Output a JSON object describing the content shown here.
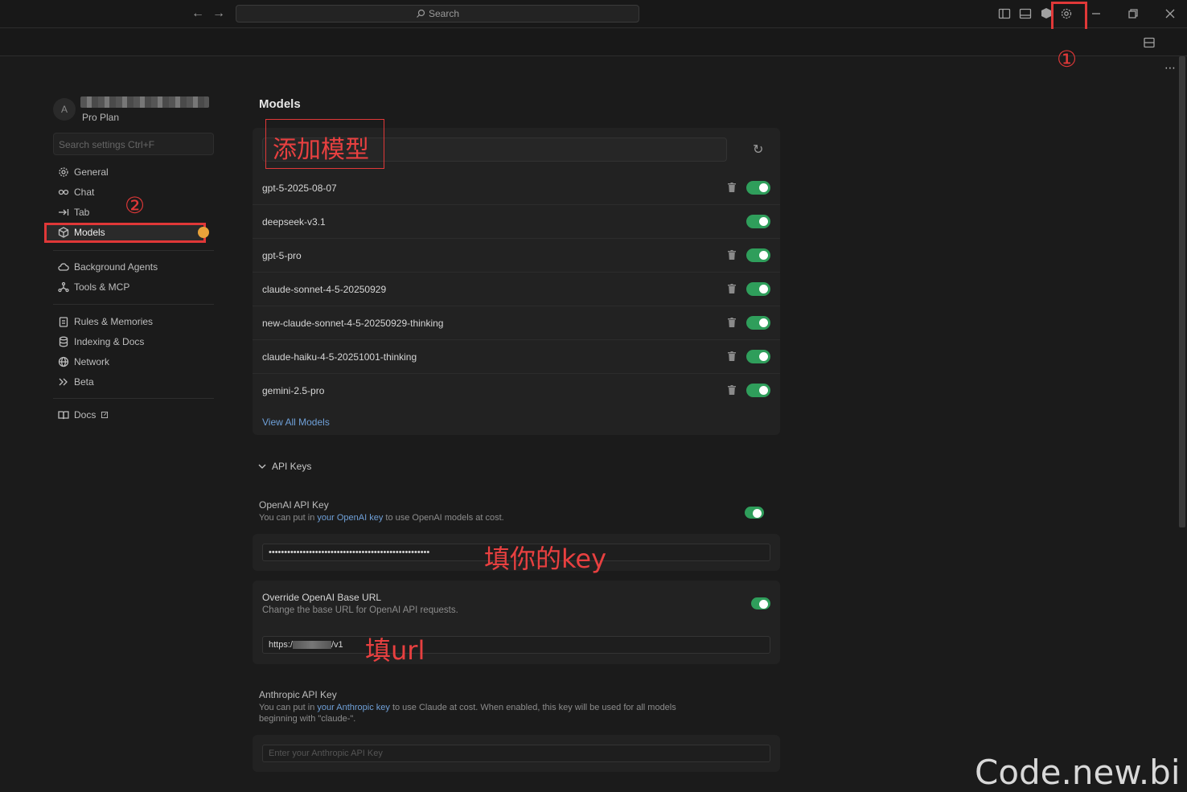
{
  "titlebar": {
    "search_label": "Search",
    "icons": [
      "back-arrow-icon",
      "forward-arrow-icon",
      "search-icon",
      "sidebar-left-icon",
      "panel-bottom-icon",
      "cube-icon",
      "gear-icon",
      "minimize-icon",
      "restore-icon",
      "close-icon"
    ]
  },
  "annotations": {
    "circle1": "①",
    "circle2": "②",
    "add_model": "添加模型",
    "fill_key": "填你的key",
    "fill_url": "填url",
    "watermark": "Code.new.bi"
  },
  "account": {
    "avatar_letter": "A",
    "plan": "Pro Plan"
  },
  "sidebar": {
    "search_placeholder": "Search settings Ctrl+F",
    "items": [
      {
        "label": "General",
        "icon": "gear-icon"
      },
      {
        "label": "Chat",
        "icon": "infinity-icon"
      },
      {
        "label": "Tab",
        "icon": "tab-arrow-icon"
      },
      {
        "label": "Models",
        "icon": "cube-icon"
      },
      {
        "label": "Background Agents",
        "icon": "cloud-icon"
      },
      {
        "label": "Tools & MCP",
        "icon": "nodes-icon"
      },
      {
        "label": "Rules & Memories",
        "icon": "clipboard-icon"
      },
      {
        "label": "Indexing & Docs",
        "icon": "database-icon"
      },
      {
        "label": "Network",
        "icon": "globe-icon"
      },
      {
        "label": "Beta",
        "icon": "chevrons-icon"
      },
      {
        "label": "Docs",
        "icon": "book-icon"
      }
    ]
  },
  "main": {
    "title": "Models",
    "models": [
      {
        "name": "gpt-5-2025-08-07",
        "deletable": true,
        "enabled": true
      },
      {
        "name": "deepseek-v3.1",
        "deletable": false,
        "enabled": true
      },
      {
        "name": "gpt-5-pro",
        "deletable": true,
        "enabled": true
      },
      {
        "name": "claude-sonnet-4-5-20250929",
        "deletable": true,
        "enabled": true
      },
      {
        "name": "new-claude-sonnet-4-5-20250929-thinking",
        "deletable": true,
        "enabled": true
      },
      {
        "name": "claude-haiku-4-5-20251001-thinking",
        "deletable": true,
        "enabled": true
      },
      {
        "name": "gemini-2.5-pro",
        "deletable": true,
        "enabled": true
      }
    ],
    "view_all": "View All Models",
    "api_keys_header": "API Keys",
    "openai": {
      "label": "OpenAI API Key",
      "desc_pre": "You can put in ",
      "desc_link": "your OpenAI key",
      "desc_post": " to use OpenAI models at cost.",
      "key_value": "••••••••••••••••••••••••••••••••••••••••••••••••••••"
    },
    "override": {
      "label": "Override OpenAI Base URL",
      "desc": "Change the base URL for OpenAI API requests.",
      "url_prefix": "https:/",
      "url_suffix": "/v1"
    },
    "anthropic": {
      "label": "Anthropic API Key",
      "desc_pre": "You can put in ",
      "desc_link": "your Anthropic key",
      "desc_post1": " to use Claude at cost. When enabled, this key will be used for all models",
      "desc_post2": "beginning with \"claude-\".",
      "placeholder": "Enter your Anthropic API Key"
    }
  },
  "colors": {
    "accent_toggle": "#2f9e5b",
    "annotation_red": "#e03838",
    "link_blue": "#6fa0d8"
  }
}
